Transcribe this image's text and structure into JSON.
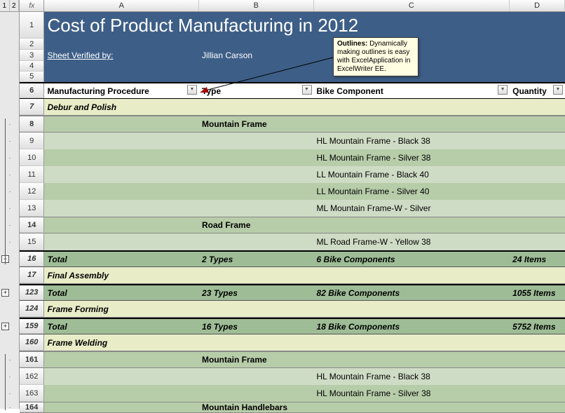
{
  "cols": [
    "A",
    "B",
    "C",
    "D"
  ],
  "outline": {
    "levels": [
      "1",
      "2"
    ]
  },
  "title": "Cost of Product Manufacturing in 2012",
  "verified": {
    "label": "Sheet Verified by:",
    "name": "Jillian Carson"
  },
  "callout": {
    "bold": "Outlines:",
    "text": " Dynamically making outlines is easy with ExcelApplication in ExcelWriter EE."
  },
  "headers": {
    "a": "Manufacturing Procedure",
    "b": "Type",
    "c": "Bike Component",
    "d": "Quantity"
  },
  "rows": [
    {
      "num": "1",
      "type": "title",
      "h": 38
    },
    {
      "num": "2",
      "type": "blank-blue",
      "h": 16
    },
    {
      "num": "3",
      "type": "verified",
      "h": 16
    },
    {
      "num": "4",
      "type": "blank-blue",
      "h": 15
    },
    {
      "num": "5",
      "type": "blank-blue",
      "h": 15
    },
    {
      "num": "6",
      "type": "headers",
      "h": 24
    },
    {
      "num": "7",
      "type": "section",
      "a": "Debur and Polish",
      "h": 24
    },
    {
      "num": "8",
      "type": "subhead",
      "b": "Mountain Frame",
      "h": 24,
      "ol": "dot"
    },
    {
      "num": "9",
      "type": "data-a",
      "c": "HL Mountain Frame - Black 38",
      "h": 24,
      "ol": "dot"
    },
    {
      "num": "10",
      "type": "data-b",
      "c": "HL Mountain Frame - Silver 38",
      "h": 24,
      "ol": "dot"
    },
    {
      "num": "11",
      "type": "data-a",
      "c": "LL Mountain Frame - Black 40",
      "h": 24,
      "ol": "dot"
    },
    {
      "num": "12",
      "type": "data-b",
      "c": "LL Mountain Frame - Silver 40",
      "h": 24,
      "ol": "dot"
    },
    {
      "num": "13",
      "type": "data-a",
      "c": "ML Mountain Frame-W - Silver",
      "h": 24,
      "ol": "dot"
    },
    {
      "num": "14",
      "type": "subhead",
      "b": "Road Frame",
      "h": 24,
      "ol": "dot"
    },
    {
      "num": "15",
      "type": "data-a",
      "c": "ML Road Frame-W - Yellow 38",
      "h": 24,
      "ol": "dot"
    },
    {
      "num": "16",
      "type": "total",
      "a": "Total",
      "b": "2 Types",
      "c": "6 Bike Components",
      "d": "24 Items",
      "h": 24,
      "ol": "minus"
    },
    {
      "num": "17",
      "type": "section",
      "a": "Final Assembly",
      "h": 24
    },
    {
      "num": "123",
      "type": "total",
      "a": "Total",
      "b": "23 Types",
      "c": "82 Bike Components",
      "d": "1055 Items",
      "h": 24,
      "ol": "plus"
    },
    {
      "num": "124",
      "type": "section",
      "a": "Frame Forming",
      "h": 24
    },
    {
      "num": "159",
      "type": "total",
      "a": "Total",
      "b": "16 Types",
      "c": "18 Bike Components",
      "d": "5752 Items",
      "h": 24,
      "ol": "plus"
    },
    {
      "num": "160",
      "type": "section",
      "a": "Frame Welding",
      "h": 24
    },
    {
      "num": "161",
      "type": "subhead",
      "b": "Mountain Frame",
      "h": 24,
      "ol": "dot"
    },
    {
      "num": "162",
      "type": "data-a",
      "c": "HL Mountain Frame - Black 38",
      "h": 24,
      "ol": "dot"
    },
    {
      "num": "163",
      "type": "data-b",
      "c": "HL Mountain Frame - Silver 38",
      "h": 24,
      "ol": "dot"
    },
    {
      "num": "164",
      "type": "subhead",
      "b": "Mountain Handlebars",
      "h": 16,
      "ol": "dot"
    }
  ]
}
